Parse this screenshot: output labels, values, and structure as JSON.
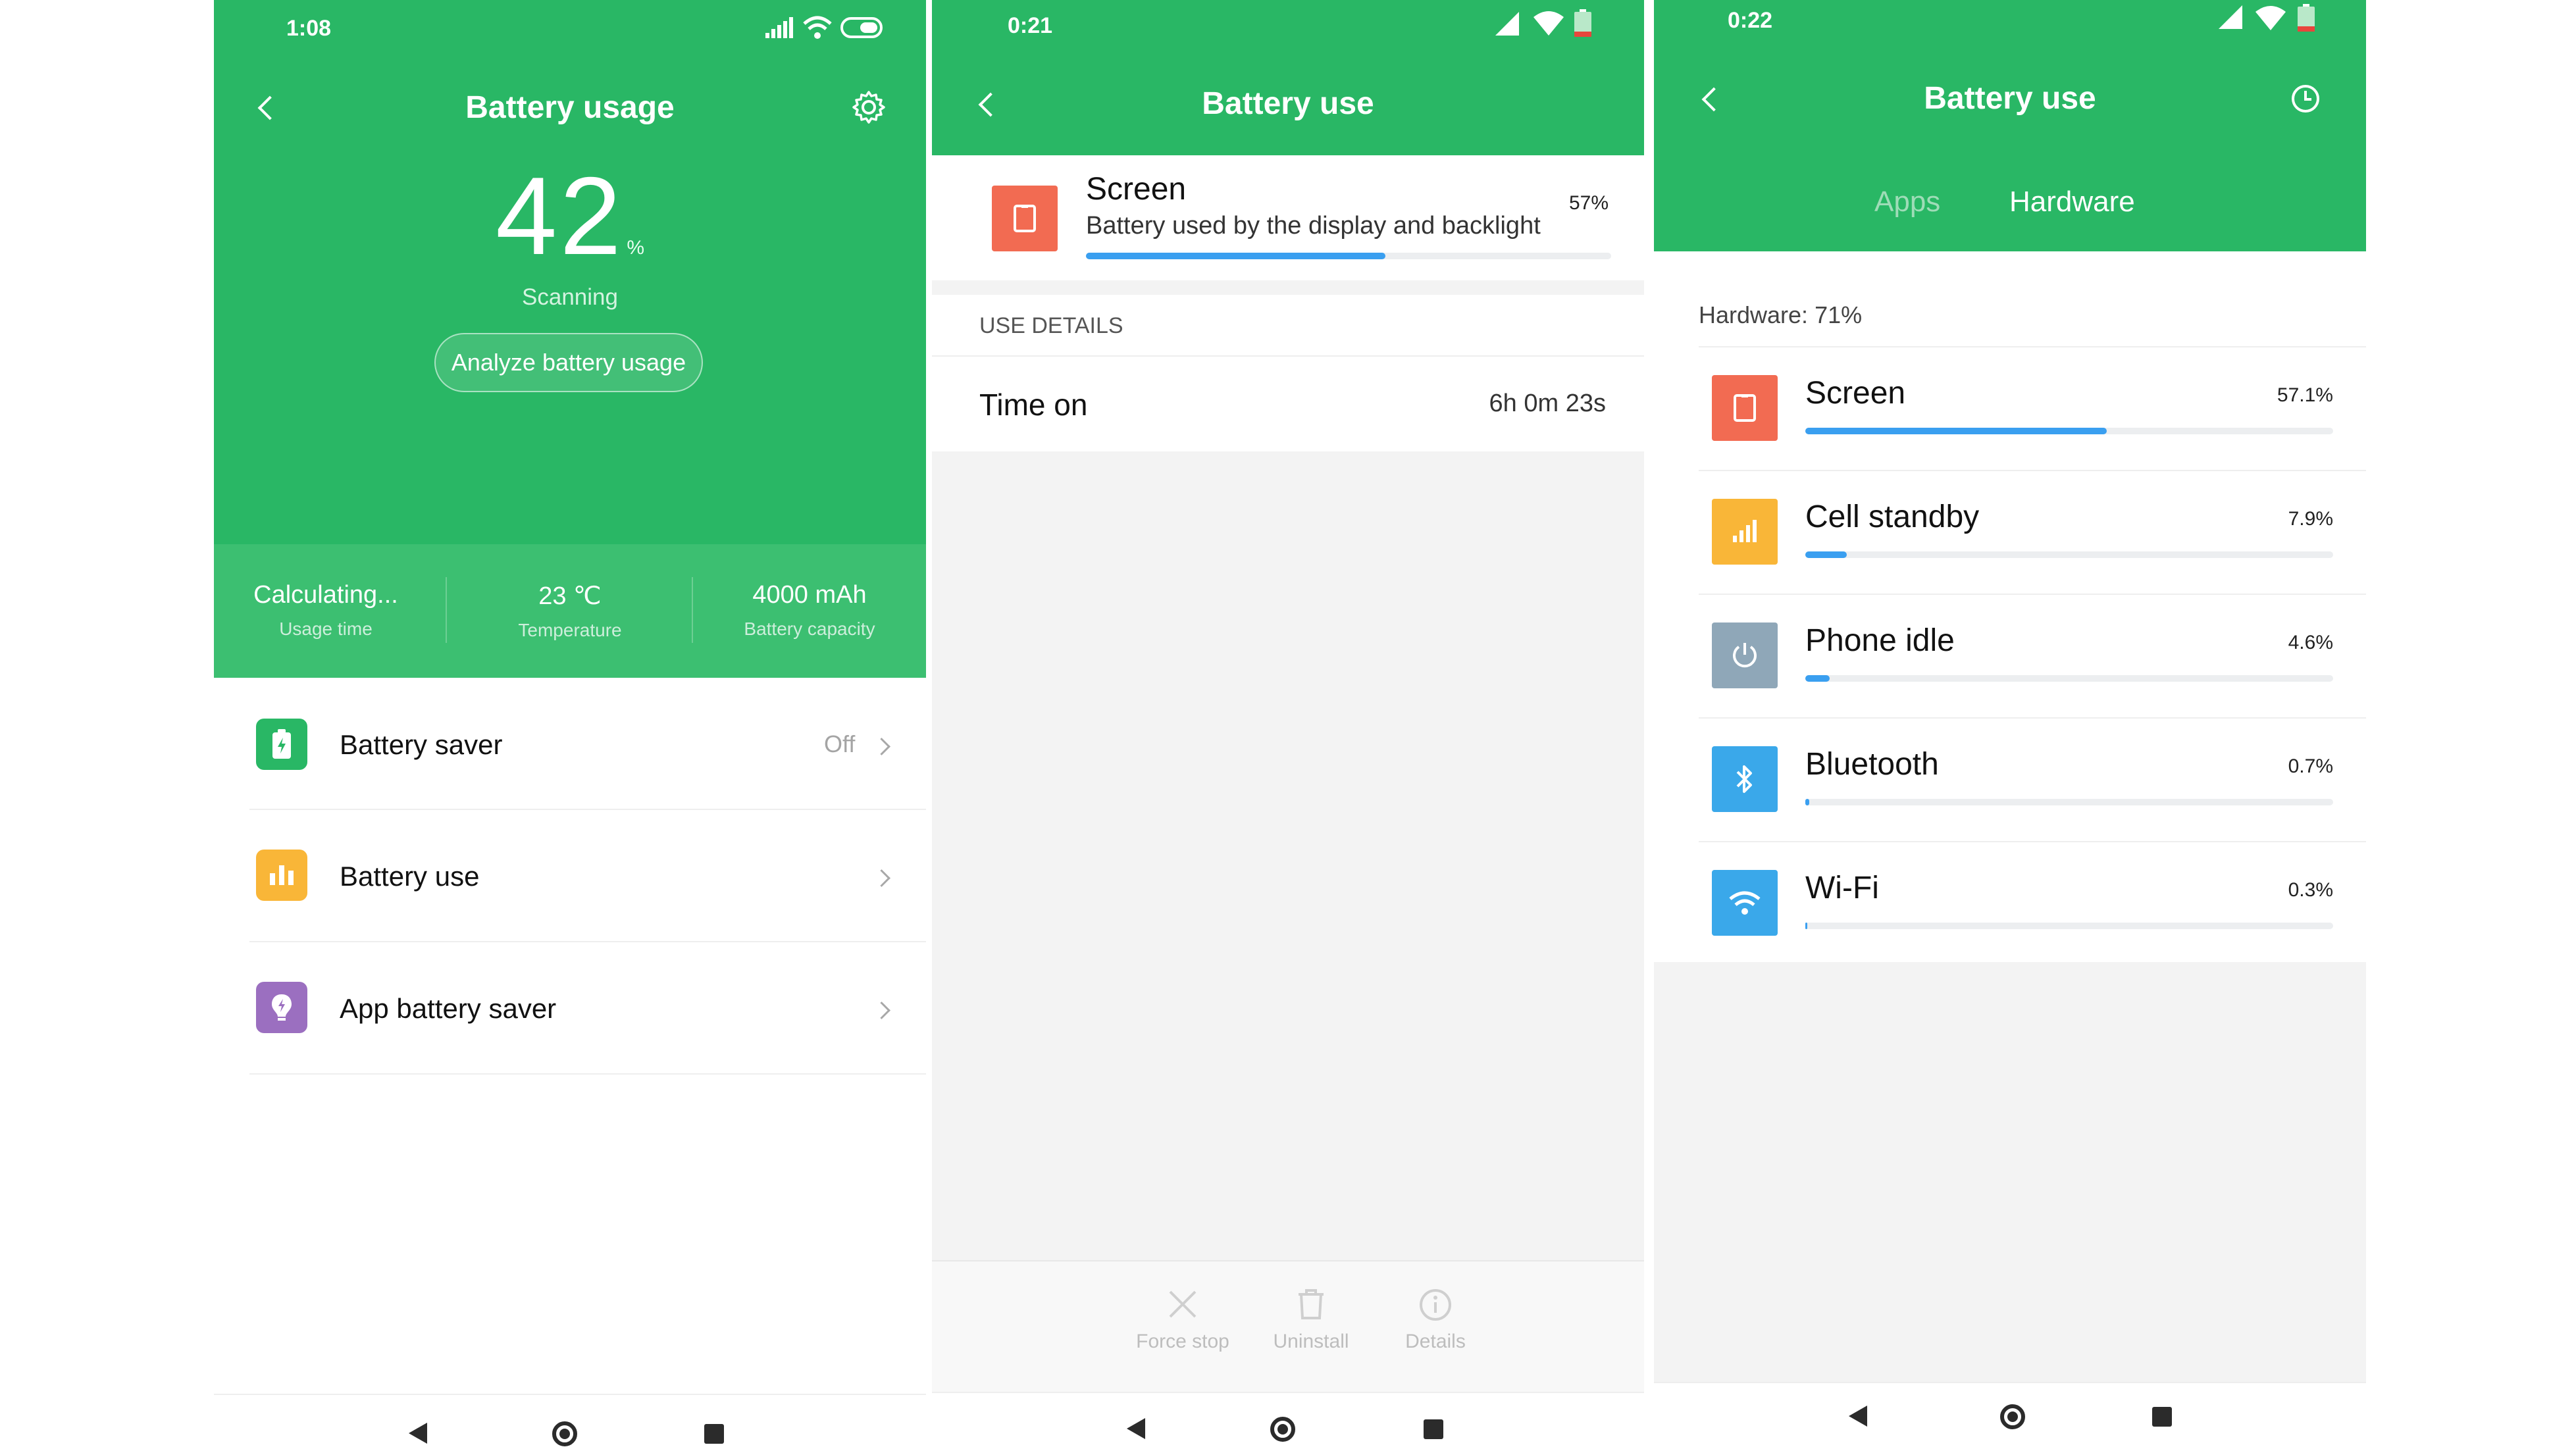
{
  "colors": {
    "accent_green": "#29b765",
    "bar_blue": "#3a9ff0",
    "screen_icon": "#f26b52",
    "cell_icon": "#f9b638",
    "idle_icon": "#8fa7b8",
    "bt_icon": "#3aa8ea",
    "wifi_icon": "#3aa8ea"
  },
  "panel1": {
    "status_time": "1:08",
    "title": "Battery usage",
    "percent": "42",
    "percent_unit": "%",
    "scanning": "Scanning",
    "analyze_button": "Analyze battery usage",
    "stats": [
      {
        "value": "Calculating...",
        "label": "Usage time"
      },
      {
        "value": "23 ℃",
        "label": "Temperature"
      },
      {
        "value": "4000 mAh",
        "label": "Battery capacity"
      }
    ],
    "rows": [
      {
        "label": "Battery saver",
        "value": "Off",
        "icon": "battery-saver-icon"
      },
      {
        "label": "Battery use",
        "value": "",
        "icon": "bar-chart-icon"
      },
      {
        "label": "App battery saver",
        "value": "",
        "icon": "app-saver-icon"
      }
    ]
  },
  "panel2": {
    "status_time": "0:21",
    "title": "Battery use",
    "item": {
      "name": "Screen",
      "description": "Battery used by the display and backlight",
      "percent": "57%",
      "fraction": 0.57
    },
    "section_header": "USE DETAILS",
    "detail": {
      "label": "Time on",
      "value": "6h 0m 23s"
    },
    "actions": [
      {
        "label": "Force stop",
        "icon": "close-icon"
      },
      {
        "label": "Uninstall",
        "icon": "trash-icon"
      },
      {
        "label": "Details",
        "icon": "info-icon"
      }
    ]
  },
  "panel3": {
    "status_time": "0:22",
    "title": "Battery use",
    "tabs": [
      "Apps",
      "Hardware"
    ],
    "summary": "Hardware: 71%",
    "items": [
      {
        "name": "Screen",
        "percent": "57.1%",
        "fraction": 0.571,
        "icon": "screen-icon"
      },
      {
        "name": "Cell standby",
        "percent": "7.9%",
        "fraction": 0.079,
        "icon": "signal-icon"
      },
      {
        "name": "Phone idle",
        "percent": "4.6%",
        "fraction": 0.046,
        "icon": "power-icon"
      },
      {
        "name": "Bluetooth",
        "percent": "0.7%",
        "fraction": 0.007,
        "icon": "bluetooth-icon"
      },
      {
        "name": "Wi-Fi",
        "percent": "0.3%",
        "fraction": 0.003,
        "icon": "wifi-icon"
      }
    ]
  }
}
